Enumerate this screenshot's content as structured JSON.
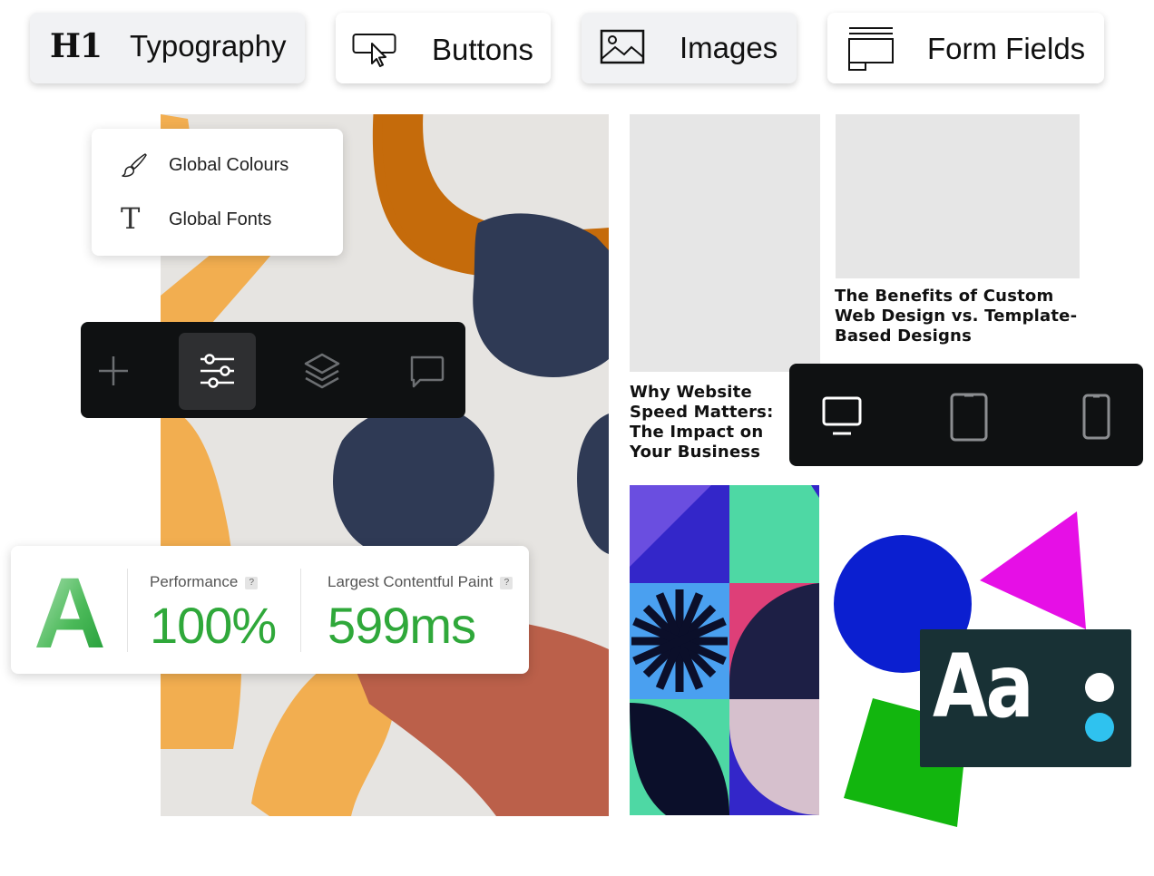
{
  "top_chips": [
    {
      "label": "Typography",
      "icon": "heading-h1-icon",
      "icon_text": "H1"
    },
    {
      "label": "Buttons",
      "icon": "button-cursor-icon"
    },
    {
      "label": "Images",
      "icon": "image-icon"
    },
    {
      "label": "Form Fields",
      "icon": "form-field-icon"
    }
  ],
  "global_menu": {
    "items": [
      {
        "label": "Global Colours",
        "icon": "paintbrush-icon"
      },
      {
        "label": "Global Fonts",
        "icon": "font-t-icon",
        "icon_text": "T"
      }
    ]
  },
  "toolbar": {
    "items": [
      {
        "name": "add",
        "icon": "plus-icon",
        "active": false
      },
      {
        "name": "settings",
        "icon": "sliders-icon",
        "active": true
      },
      {
        "name": "layers",
        "icon": "layers-icon",
        "active": false
      },
      {
        "name": "comments",
        "icon": "comment-icon",
        "active": false
      }
    ]
  },
  "device_bar": {
    "items": [
      {
        "name": "desktop",
        "icon": "desktop-icon",
        "active": true
      },
      {
        "name": "tablet",
        "icon": "tablet-icon",
        "active": false
      },
      {
        "name": "mobile",
        "icon": "mobile-icon",
        "active": false
      }
    ]
  },
  "articles": [
    {
      "title": "The Benefits of Custom Web Design vs. Template-Based Designs"
    },
    {
      "title": "Why Website Speed Matters: The Impact on Your Business"
    }
  ],
  "performance": {
    "grade": "A",
    "metrics": [
      {
        "label": "Performance",
        "value": "100%",
        "help": "?"
      },
      {
        "label": "Largest Contentful Paint",
        "value": "599ms",
        "help": "?"
      }
    ],
    "value_color": "#2fa83a"
  },
  "type_card": {
    "sample": "Aa"
  },
  "colors": {
    "orange_light": "#f2ae50",
    "orange_dark": "#c56b0b",
    "navy": "#2f3a55",
    "terracotta": "#bb604a",
    "canvas": "#e6e4e1",
    "toolbar_bg": "#0f1112",
    "blue": "#0b1fd0",
    "magenta": "#e60fe6",
    "green": "#12b60e",
    "type_card_bg": "#183135",
    "cyan_dot": "#2fc2ef"
  }
}
